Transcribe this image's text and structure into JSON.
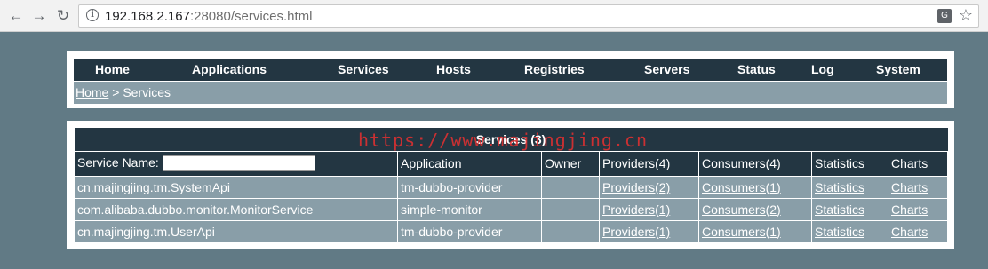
{
  "browser": {
    "back_icon": "back-arrow-icon",
    "forward_icon": "forward-arrow-icon",
    "reload_icon": "reload-icon",
    "url_host": "192.168.2.167",
    "url_rest": ":28080/services.html"
  },
  "menu": {
    "home": "Home",
    "applications": "Applications",
    "services": "Services",
    "hosts": "Hosts",
    "registries": "Registries",
    "servers": "Servers",
    "status": "Status",
    "log": "Log",
    "system": "System"
  },
  "breadcrumb": {
    "home": "Home",
    "separator": " > Services"
  },
  "table": {
    "caption": "Services (3)",
    "headers": {
      "service_name": "Service Name:",
      "application": "Application",
      "owner": "Owner",
      "providers": "Providers(4)",
      "consumers": "Consumers(4)",
      "statistics": "Statistics",
      "charts": "Charts"
    },
    "search_value": "",
    "rows": [
      {
        "service": "cn.majingjing.tm.SystemApi",
        "application": "tm-dubbo-provider",
        "owner": "",
        "providers": "Providers(2)",
        "consumers": "Consumers(1)",
        "statistics": "Statistics",
        "charts": "Charts"
      },
      {
        "service": "com.alibaba.dubbo.monitor.MonitorService",
        "application": "simple-monitor",
        "owner": "",
        "providers": "Providers(1)",
        "consumers": "Consumers(2)",
        "statistics": "Statistics",
        "charts": "Charts"
      },
      {
        "service": "cn.majingjing.tm.UserApi",
        "application": "tm-dubbo-provider",
        "owner": "",
        "providers": "Providers(1)",
        "consumers": "Consumers(1)",
        "statistics": "Statistics",
        "charts": "Charts"
      }
    ]
  },
  "watermark": "https://www.majingjing.cn"
}
